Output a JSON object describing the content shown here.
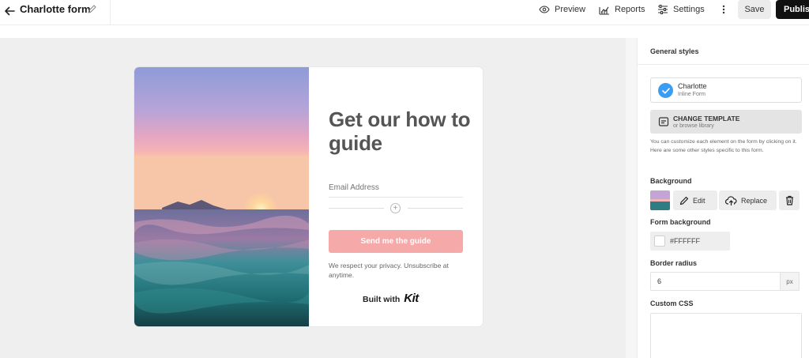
{
  "topbar": {
    "form_title": "Charlotte form",
    "preview_label": "Preview",
    "reports_label": "Reports",
    "settings_label": "Settings",
    "save_label": "Save",
    "publish_label": "Publish"
  },
  "form": {
    "headline": "Get our how to guide",
    "email_placeholder": "Email Address",
    "submit_label": "Send me the guide",
    "privacy_text": "We respect your privacy. Unsubscribe at anytime.",
    "built_with_label": "Built with",
    "brand_name": "Kit",
    "button_color": "#f5a9a9",
    "headline_color": "#555555"
  },
  "panel": {
    "title": "General styles",
    "template": {
      "name": "Charlotte",
      "type": "Inline Form"
    },
    "change_template": {
      "title": "CHANGE TEMPLATE",
      "subtitle": "or browse library"
    },
    "help_text": "You can customize each element on the form by clicking on it. Here are some other styles specific to this form.",
    "background": {
      "label": "Background",
      "edit_label": "Edit",
      "replace_label": "Replace"
    },
    "form_background": {
      "label": "Form background",
      "value": "#FFFFFF"
    },
    "border_radius": {
      "label": "Border radius",
      "value": "6",
      "unit": "px"
    },
    "custom_css": {
      "label": "Custom CSS",
      "value": ""
    }
  },
  "colors": {
    "accent_blue": "#3b9df2",
    "publish_bg": "#111111",
    "canvas_bg": "#efefef"
  },
  "icons": [
    "back-arrow-icon",
    "pencil-icon",
    "eye-icon",
    "chart-icon",
    "sliders-icon",
    "more-vertical-icon",
    "check-icon",
    "template-icon",
    "upload-cloud-icon",
    "trash-icon",
    "plus-icon"
  ]
}
